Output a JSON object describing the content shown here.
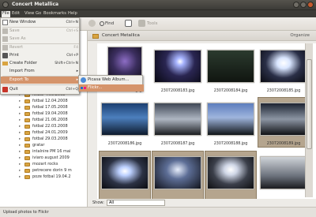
{
  "window": {
    "title": "Concert Metallica"
  },
  "menubar": [
    "File",
    "Edit",
    "View",
    "Go",
    "Bookmarks",
    "Help"
  ],
  "toolbar": {
    "find_label": "Find",
    "tools_label": "Tools"
  },
  "file_menu": {
    "items": [
      {
        "label": "New Window",
        "accel": "Ctrl+N",
        "enabled": true,
        "icon": "new-window-icon"
      },
      {
        "label": "Save",
        "accel": "Ctrl+S",
        "enabled": false,
        "icon": "save-icon"
      },
      {
        "label": "Save As",
        "accel": "",
        "enabled": false,
        "icon": "save-as-icon"
      },
      {
        "label": "Revert",
        "accel": "F4",
        "enabled": false,
        "icon": "revert-icon"
      },
      {
        "label": "Print",
        "accel": "Ctrl+P",
        "enabled": true,
        "icon": "print-icon"
      },
      {
        "label": "Create Folder",
        "accel": "Shift+Ctrl+N",
        "enabled": true,
        "icon": "folder-icon"
      },
      {
        "label": "Import From",
        "accel": "",
        "enabled": true,
        "icon": ""
      },
      {
        "label": "Export To",
        "accel": "",
        "enabled": true,
        "icon": ""
      },
      {
        "label": "Quit",
        "accel": "Ctrl+Q",
        "enabled": true,
        "icon": "quit-icon"
      }
    ]
  },
  "export_submenu": [
    {
      "label": "Picasa Web Album...",
      "icon": "picasa-icon"
    },
    {
      "label": "Flickr...",
      "icon": "flickr-icon"
    }
  ],
  "sidebar": {
    "folders": [
      "fotbal 4.05.2008",
      "fotbal 12.04.2008",
      "fotbal 17.05.2008",
      "fotbal 19.04.2008",
      "fotbal 21.06.2008",
      "fotbal 22.03.2008",
      "fotbal 24.01.2009",
      "fotbal 29.03.2008",
      "gratar",
      "intalnire PM 16 mai",
      "iviaro august 2009",
      "mozart rocks",
      "petrecere dorin 9 m",
      "poze fotbal 19.04.2"
    ]
  },
  "viewer": {
    "folder_title": "Concert Metallica",
    "organize_label": "Organize",
    "thumbnails": [
      {
        "name": "23072008182.jpg",
        "selected": false
      },
      {
        "name": "23072008183.jpg",
        "selected": false
      },
      {
        "name": "23072008184.jpg",
        "selected": false
      },
      {
        "name": "23072008185.jpg",
        "selected": false
      },
      {
        "name": "23072008186.jpg",
        "selected": false
      },
      {
        "name": "23072008187.jpg",
        "selected": false
      },
      {
        "name": "23072008188.jpg",
        "selected": false
      },
      {
        "name": "23072008189.jpg",
        "selected": true
      },
      {
        "name": "",
        "selected": true
      },
      {
        "name": "",
        "selected": true
      },
      {
        "name": "",
        "selected": true
      },
      {
        "name": "",
        "selected": false
      }
    ],
    "show_label": "Show:",
    "show_value": "All"
  },
  "statusbar": {
    "text": "Upload photos to Flickr"
  },
  "colors": {
    "menu_highlight": "#d5946b",
    "folder": "#d9a441",
    "window_chrome": "#3c3b37"
  }
}
